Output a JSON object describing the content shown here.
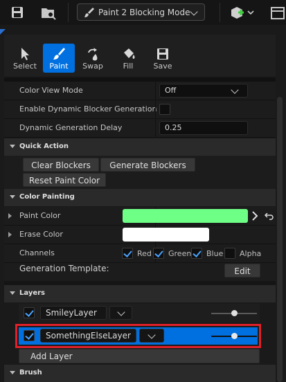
{
  "toolbar": {
    "save_icon": "save-icon",
    "browse_icon": "browse-icon",
    "mode_label": "Paint 2 Blocking Mode",
    "add_icon": "add-actor-icon",
    "more_icon": "more-icon"
  },
  "tools": {
    "select": "Select",
    "paint": "Paint",
    "swap": "Swap",
    "fill": "Fill",
    "save": "Save"
  },
  "settings": {
    "color_view_mode_label": "Color View Mode",
    "color_view_mode_value": "Off",
    "dynamic_blocker_label": "Enable Dynamic Blocker Generation",
    "dynamic_delay_label": "Dynamic Generation Delay",
    "dynamic_delay_value": "0.25"
  },
  "quick_action": {
    "title": "Quick Action",
    "clear": "Clear Blockers",
    "generate": "Generate Blockers",
    "reset": "Reset Paint Color"
  },
  "color_painting": {
    "title": "Color Painting",
    "paint_color_label": "Paint Color",
    "paint_color": "#6eff86",
    "erase_color_label": "Erase Color",
    "erase_color": "#ffffff",
    "channels_label": "Channels",
    "red": "Red",
    "green": "Green",
    "blue": "Blue",
    "alpha": "Alpha",
    "template_label": "Generation Template:",
    "edit": "Edit"
  },
  "layers": {
    "title": "Layers",
    "items": [
      {
        "name": "SmileyLayer"
      },
      {
        "name": "SomethingElseLayer"
      }
    ],
    "add": "Add Layer"
  },
  "brush": {
    "title": "Brush"
  },
  "colors": {
    "accent": "#0070e0",
    "highlight_border": "#e0202a"
  }
}
